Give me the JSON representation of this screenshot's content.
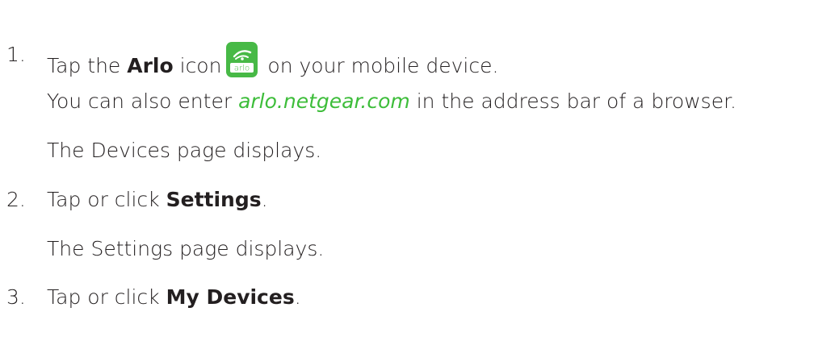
{
  "steps": [
    {
      "number": "1.",
      "prefix": "Tap the ",
      "bold": "Arlo",
      "mid": " icon",
      "suffix": " on your mobile device.",
      "icon": "arlo-app-icon",
      "icon_label": "arlo",
      "notes": [
        {
          "before": "You can also enter ",
          "link": "arlo.netgear.com",
          "after": " in the address bar of a browser."
        },
        {
          "text": "The Devices page displays."
        }
      ]
    },
    {
      "number": "2.",
      "prefix": "Tap or click ",
      "bold": "Settings",
      "suffix": ".",
      "notes": [
        {
          "text": "The Settings page displays."
        }
      ]
    },
    {
      "number": "3.",
      "prefix": "Tap or click ",
      "bold": "My Devices",
      "suffix": "."
    }
  ],
  "colors": {
    "text": "#231f20",
    "link": "#3dbd3a",
    "icon_background": "#47b946"
  }
}
